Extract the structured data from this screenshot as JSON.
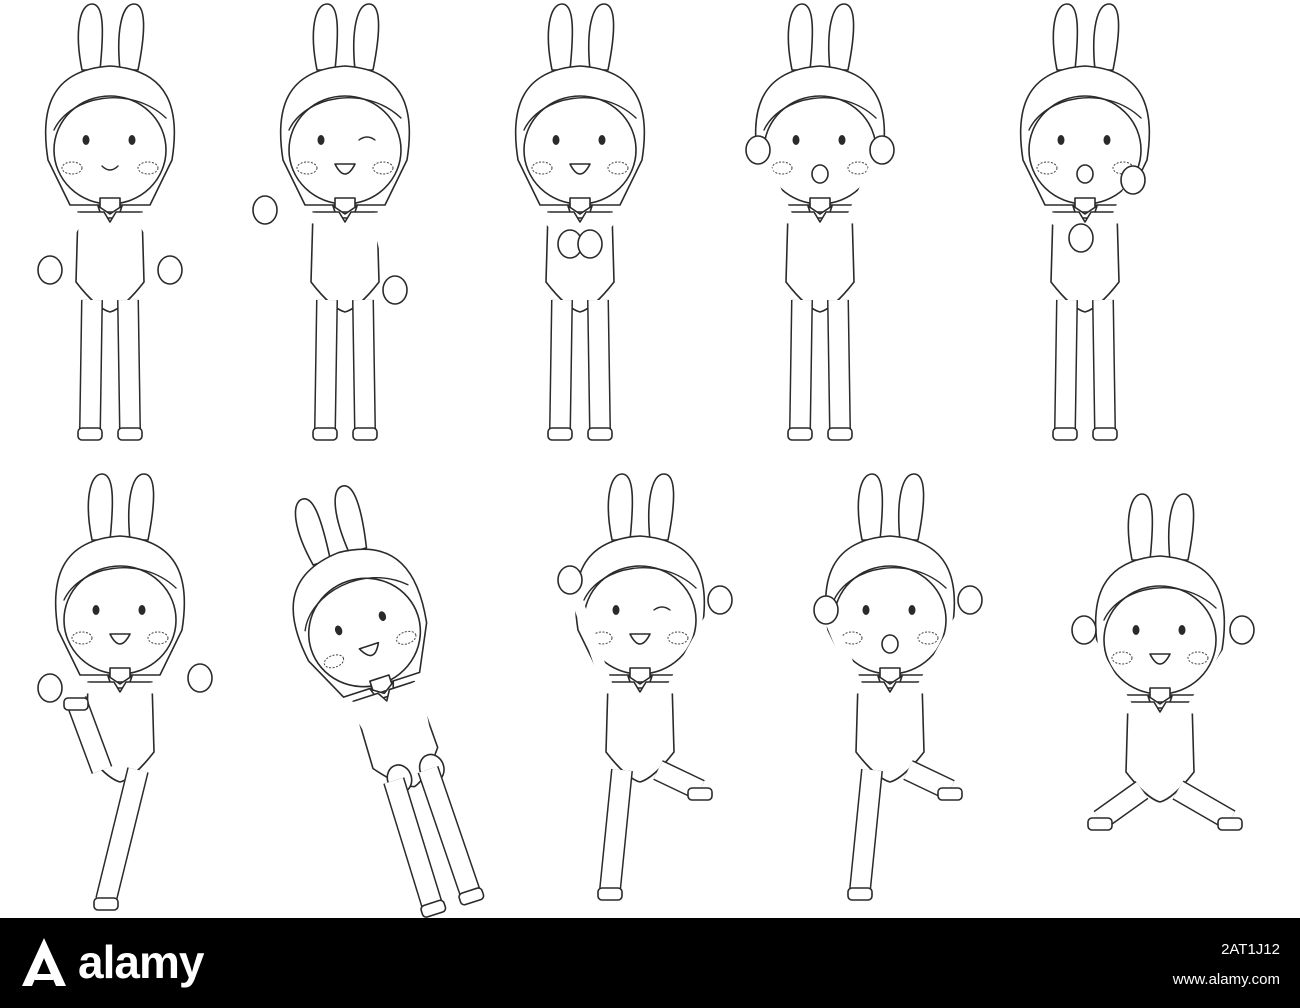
{
  "image": {
    "subject": "",
    "figures": [
      {
        "pose": "standing"
      },
      {
        "pose": "presenting-wink"
      },
      {
        "pose": "hands-on-chest"
      },
      {
        "pose": "crying"
      },
      {
        "pose": "surprised-hand-on-cheek"
      },
      {
        "pose": "kick"
      },
      {
        "pose": "bowing"
      },
      {
        "pose": "jump-wink"
      },
      {
        "pose": "jump-surprised"
      },
      {
        "pose": "leap"
      }
    ]
  },
  "banner": {
    "logo_icon": "alamy-a-icon",
    "brand": "alamy",
    "stock_id": "2AT1J12",
    "url": "www.alamy.com"
  },
  "colors": {
    "banner_bg": "#000000",
    "text": "#ffffff",
    "outline": "#2a2a2a"
  }
}
